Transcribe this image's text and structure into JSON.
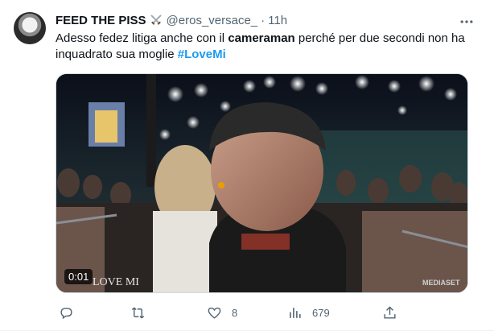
{
  "tweet": {
    "display_name": "FEED THE PISS",
    "handle": "@eros_versace_",
    "separator": "·",
    "time": "11h",
    "text_parts": {
      "p1": "Adesso fedez litiga anche con il ",
      "bold": "cameraman",
      "p2": " perché per due secondi non ha inquadrato sua moglie ",
      "hashtag": "#LoveMi"
    },
    "media": {
      "duration": "0:01",
      "watermark_left": "LOVE MI",
      "watermark_right": "MEDIASET"
    },
    "actions": {
      "reply_icon": "reply-icon",
      "retweet_icon": "retweet-icon",
      "like_icon": "heart-icon",
      "like_count": "8",
      "views_icon": "views-icon",
      "views_count": "679",
      "share_icon": "share-icon"
    }
  },
  "colors": {
    "text": "#0f1419",
    "secondary": "#536471",
    "link": "#1d9bf0",
    "border": "#cfd9de"
  }
}
